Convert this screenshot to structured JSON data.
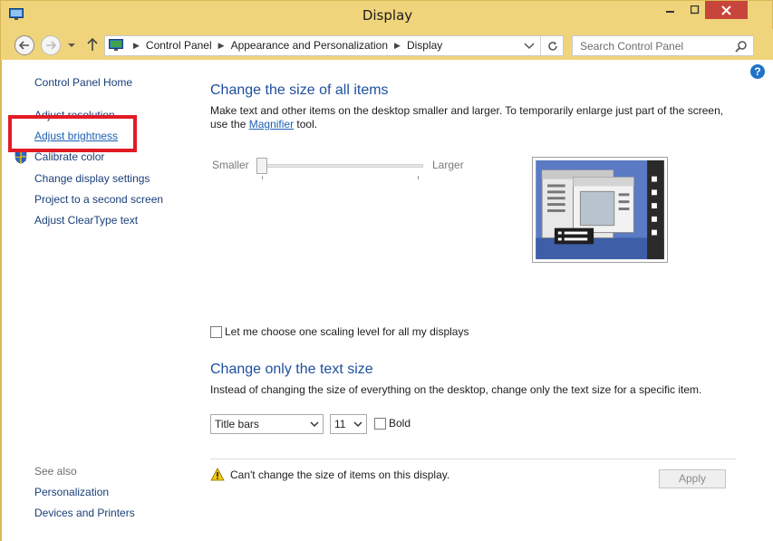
{
  "window": {
    "title": "Display",
    "colors": {
      "frame": "#f0d47c",
      "close": "#c7453a",
      "link": "#1a3e78",
      "heading": "#1e4f9e",
      "highlight": "#e21b24"
    }
  },
  "nav": {
    "breadcrumbs": [
      "Control Panel",
      "Appearance and Personalization",
      "Display"
    ],
    "search_placeholder": "Search Control Panel"
  },
  "sidebar": {
    "home": "Control Panel Home",
    "items": [
      "Adjust resolution",
      "Adjust brightness",
      "Calibrate color",
      "Change display settings",
      "Project to a second screen",
      "Adjust ClearType text"
    ],
    "see_also_label": "See also",
    "see_also": [
      "Personalization",
      "Devices and Printers"
    ]
  },
  "main": {
    "size_heading": "Change the size of all items",
    "size_desc_part1": "Make text and other items on the desktop smaller and larger. To temporarily enlarge just part of the screen, use the",
    "magnifier_link": "Magnifier",
    "size_desc_part2": "tool.",
    "slider_smaller": "Smaller",
    "slider_larger": "Larger",
    "slider_value": 0,
    "scaling_checkbox_label": "Let me choose one scaling level for all my displays",
    "scaling_checked": false,
    "text_heading": "Change only the text size",
    "text_desc": "Instead of changing the size of everything on the desktop, change only the text size for a specific item.",
    "item_select": "Title bars",
    "size_select": "11",
    "bold_label": "Bold",
    "bold_checked": false,
    "warning_text": "Can't change the size of items on this display.",
    "apply_label": "Apply"
  }
}
